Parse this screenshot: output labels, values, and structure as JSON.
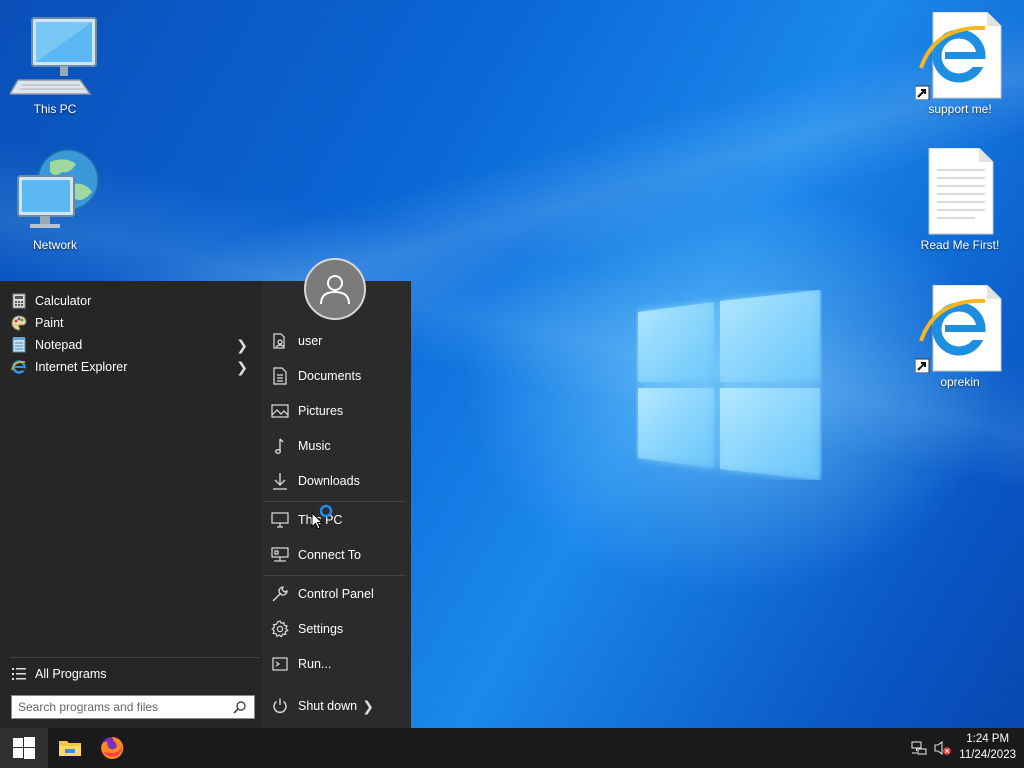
{
  "desktop": {
    "icons_left": [
      {
        "label": "This PC",
        "icon": "computer-icon"
      },
      {
        "label": "Network",
        "icon": "network-globe-icon"
      }
    ],
    "icons_right": [
      {
        "label": "support me!",
        "icon": "internet-explorer-shortcut-icon"
      },
      {
        "label": "Read Me First!",
        "icon": "text-document-icon"
      },
      {
        "label": "oprekin",
        "icon": "internet-explorer-shortcut-icon"
      }
    ]
  },
  "start_menu": {
    "programs": [
      {
        "label": "Calculator",
        "icon": "calculator-icon"
      },
      {
        "label": "Paint",
        "icon": "paint-palette-icon"
      },
      {
        "label": "Notepad",
        "icon": "notepad-icon",
        "submenu": true
      },
      {
        "label": "Internet Explorer",
        "icon": "internet-explorer-icon",
        "submenu": true
      }
    ],
    "all_programs": "All Programs",
    "search_placeholder": "Search programs and files",
    "right_items": [
      {
        "label": "user",
        "icon": "user-folder-icon"
      },
      {
        "label": "Documents",
        "icon": "document-icon"
      },
      {
        "label": "Pictures",
        "icon": "pictures-icon"
      },
      {
        "label": "Music",
        "icon": "music-note-icon"
      },
      {
        "label": "Downloads",
        "icon": "download-arrow-icon"
      },
      {
        "label": "This PC",
        "icon": "monitor-icon"
      },
      {
        "label": "Connect To",
        "icon": "network-connect-icon"
      },
      {
        "label": "Control Panel",
        "icon": "wrench-icon"
      },
      {
        "label": "Settings",
        "icon": "gear-icon"
      },
      {
        "label": "Run...",
        "icon": "run-icon"
      }
    ],
    "shutdown": "Shut down"
  },
  "taskbar": {
    "time": "1:24 PM",
    "date": "11/24/2023",
    "pinned": [
      {
        "name": "file-explorer-icon"
      },
      {
        "name": "firefox-icon"
      }
    ]
  }
}
